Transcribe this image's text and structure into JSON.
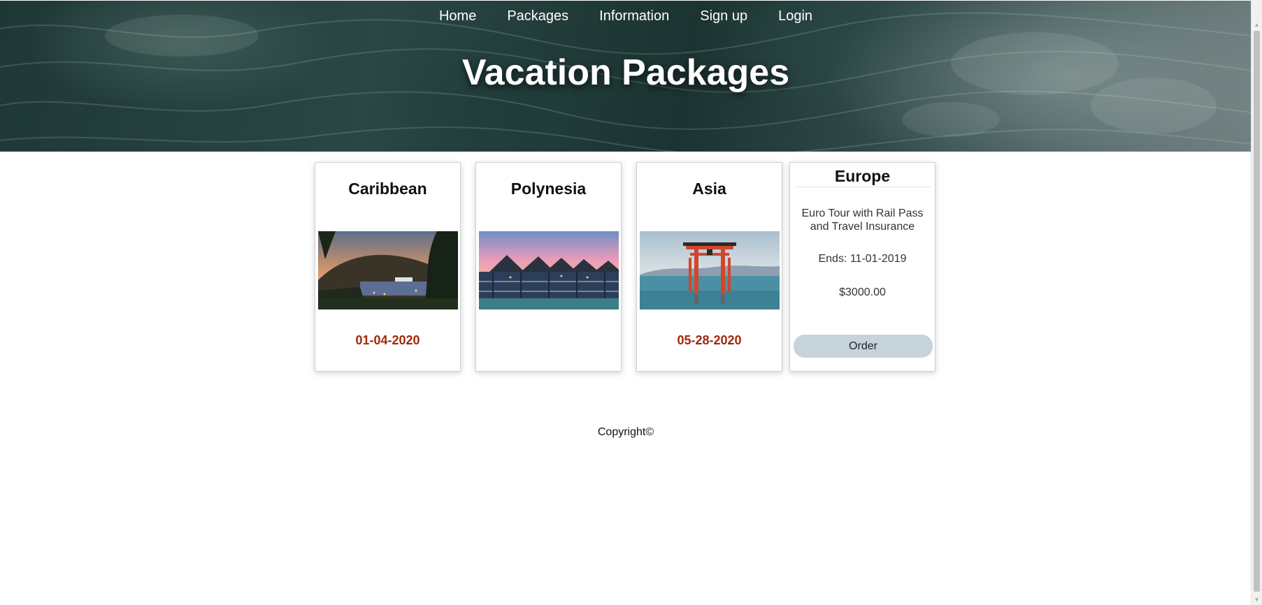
{
  "nav": {
    "items": [
      {
        "label": "Home"
      },
      {
        "label": "Packages"
      },
      {
        "label": "Information"
      },
      {
        "label": "Sign up"
      },
      {
        "label": "Login"
      }
    ]
  },
  "header": {
    "title": "Vacation Packages"
  },
  "packages": [
    {
      "name": "Caribbean",
      "date": "01-04-2020",
      "image": "tropical-bay-sunset-photo"
    },
    {
      "name": "Polynesia",
      "date": "",
      "image": "overwater-bungalows-photo"
    },
    {
      "name": "Asia",
      "date": "05-28-2020",
      "image": "torii-gate-photo"
    },
    {
      "name": "Europe",
      "description": "Euro Tour with Rail Pass and Travel Insurance",
      "ends": "Ends: 11-01-2019",
      "price": "$3000.00",
      "order_label": "Order"
    }
  ],
  "footer": {
    "copyright": "Copyright©"
  },
  "colors": {
    "date_red": "#a0280c",
    "order_button": "#c7d3db"
  }
}
